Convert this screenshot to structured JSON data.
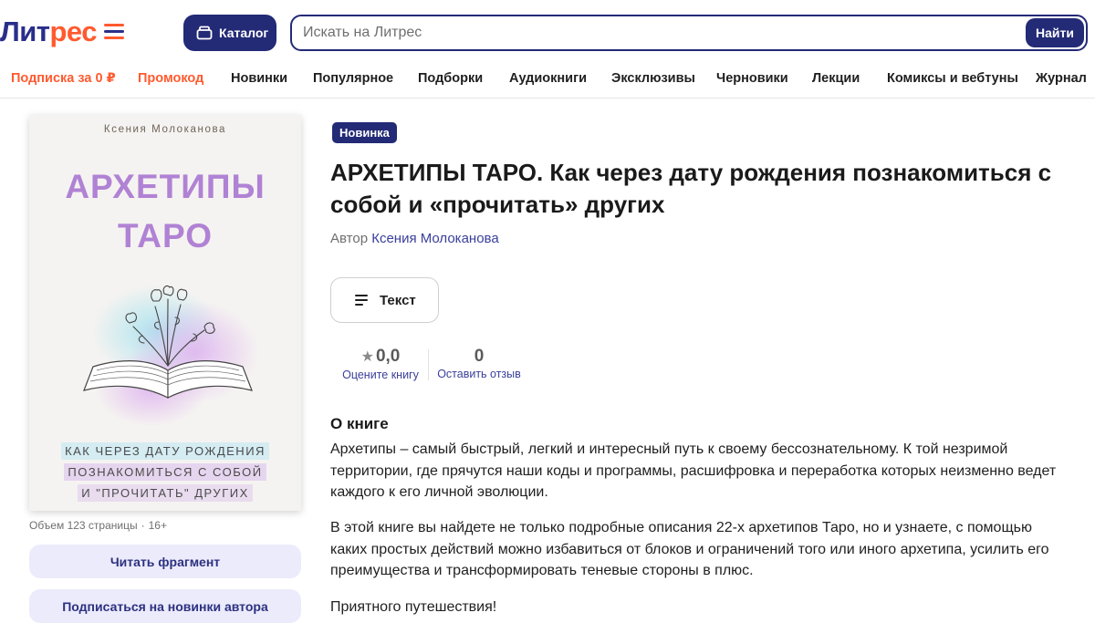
{
  "header": {
    "logo_part1": "Лит",
    "logo_part2": "рес",
    "catalog_label": "Каталог",
    "search_placeholder": "Искать на Литрес",
    "search_button": "Найти"
  },
  "nav": {
    "items": [
      {
        "label": "Подписка за 0 ₽",
        "accent": true
      },
      {
        "label": "Промокод",
        "accent": true
      },
      {
        "label": "Новинки"
      },
      {
        "label": "Популярное"
      },
      {
        "label": "Подборки"
      },
      {
        "label": "Аудиокниги"
      },
      {
        "label": "Эксклюзивы"
      },
      {
        "label": "Черновики"
      },
      {
        "label": "Лекции"
      },
      {
        "label": "Комиксы и вебтуны"
      },
      {
        "label": "Журнал"
      }
    ]
  },
  "cover": {
    "author": "Ксения Молоканова",
    "title_line1": "АРХЕТИПЫ",
    "title_line2": "ТАРО",
    "subtitle_line1": "КАК ЧЕРЕЗ ДАТУ РОЖДЕНИЯ",
    "subtitle_line2": "ПОЗНАКОМИТЬСЯ С СОБОЙ",
    "subtitle_line3": "И \"ПРОЧИТАТЬ\" ДРУГИХ"
  },
  "book_meta": {
    "volume": "Объем 123 страницы",
    "age": "16+"
  },
  "actions": {
    "read_fragment": "Читать фрагмент",
    "subscribe_author": "Подписаться на новинки автора"
  },
  "book": {
    "badge": "Новинка",
    "title": "АРХЕТИПЫ ТАРО. Как через дату рождения познакомиться с собой и «прочитать» других",
    "author_label": "Автор",
    "author_name": "Ксения Молоканова",
    "format_label": "Текст",
    "rating_value": "0,0",
    "rating_label": "Оцените книгу",
    "reviews_value": "0",
    "reviews_label": "Оставить отзыв"
  },
  "about": {
    "heading": "О книге",
    "paragraph1": "Архетипы – самый быстрый, легкий и интересный путь к своему бессознательному. К той незримой территории, где прячутся наши коды и программы, расшифровка и переработка которых неизменно ведет каждого к его личной эволюции.",
    "paragraph2": "В этой книге вы найдете не только подробные описания 22-х архетипов Таро, но и узнаете, с помощью каких простых действий можно избавиться от блоков и ограничений того или иного архетипа, усилить его преимущества и трансформировать теневые стороны в плюс.",
    "paragraph3": "Приятного путешествия!"
  },
  "colors": {
    "brand_navy": "#232a76",
    "brand_orange": "#ff5a2f",
    "link_blue": "#3a3f9a",
    "cover_title_purple": "#b082d4"
  }
}
